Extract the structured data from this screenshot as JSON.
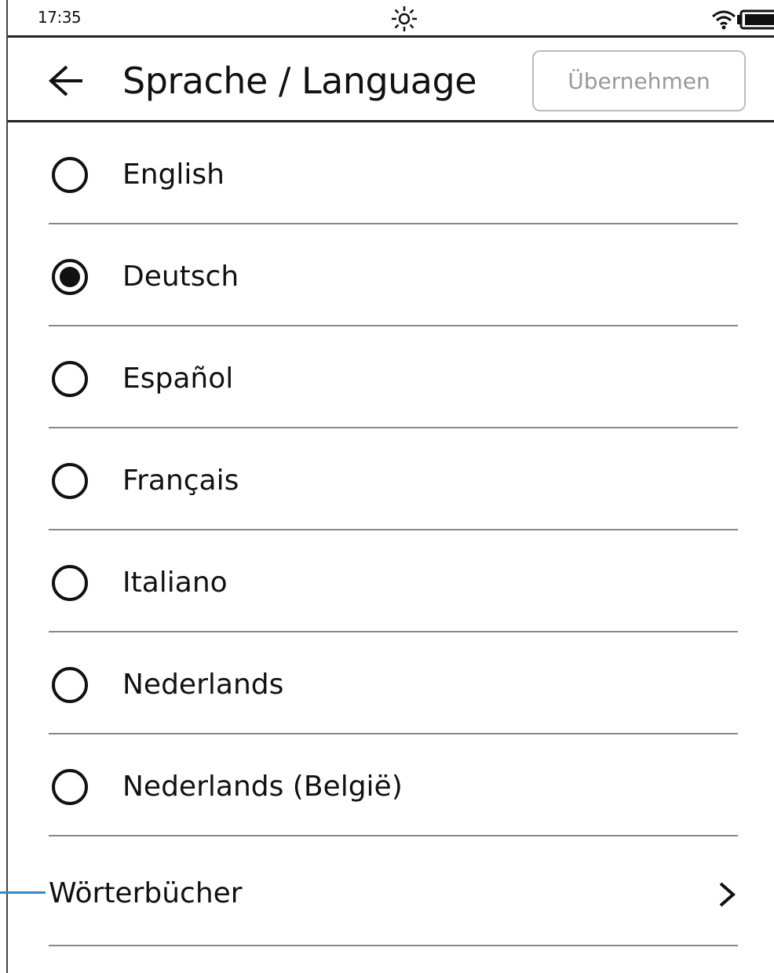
{
  "status_bar": {
    "time": "17:35",
    "frontlight_icon": "sun-icon",
    "wifi_icon": "wifi-icon",
    "battery_icon": "battery-icon"
  },
  "header": {
    "back_icon": "arrow-left-icon",
    "title": "Sprache / Language",
    "apply_label": "Übernehmen"
  },
  "languages": [
    {
      "label": "English",
      "selected": false
    },
    {
      "label": "Deutsch",
      "selected": true
    },
    {
      "label": "Español",
      "selected": false
    },
    {
      "label": "Français",
      "selected": false
    },
    {
      "label": "Italiano",
      "selected": false
    },
    {
      "label": "Nederlands",
      "selected": false
    },
    {
      "label": "Nederlands (België)",
      "selected": false
    }
  ],
  "dictionaries": {
    "label": "Wörterbücher",
    "icon": "chevron-right-icon"
  },
  "colors": {
    "text": "#111111",
    "divider": "#888888",
    "disabled_button_text": "#999999",
    "callout_line": "#3a87c2"
  }
}
